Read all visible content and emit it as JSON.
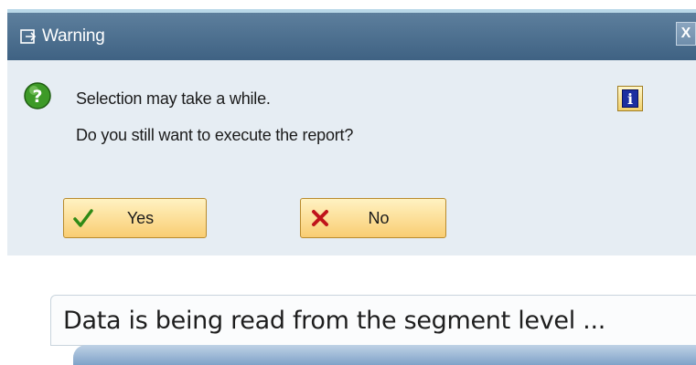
{
  "dialog": {
    "title": "Warning",
    "close_label": "X",
    "message_line1": "Selection may take a while.",
    "message_line2": "Do you still want to execute the report?",
    "yes_label": "Yes",
    "no_label": "No",
    "info_label": "i",
    "icons": {
      "title": "window-icon",
      "question": "question-icon",
      "info": "info-icon",
      "yes": "checkmark-icon",
      "no": "cross-icon"
    },
    "colors": {
      "titlebar": "#4f7192",
      "dialog_bg": "#e6edf3",
      "button": "#f9cd72",
      "question_icon": "#3d9a27"
    }
  },
  "status": {
    "text": "Data is being read from the segment level ..."
  }
}
